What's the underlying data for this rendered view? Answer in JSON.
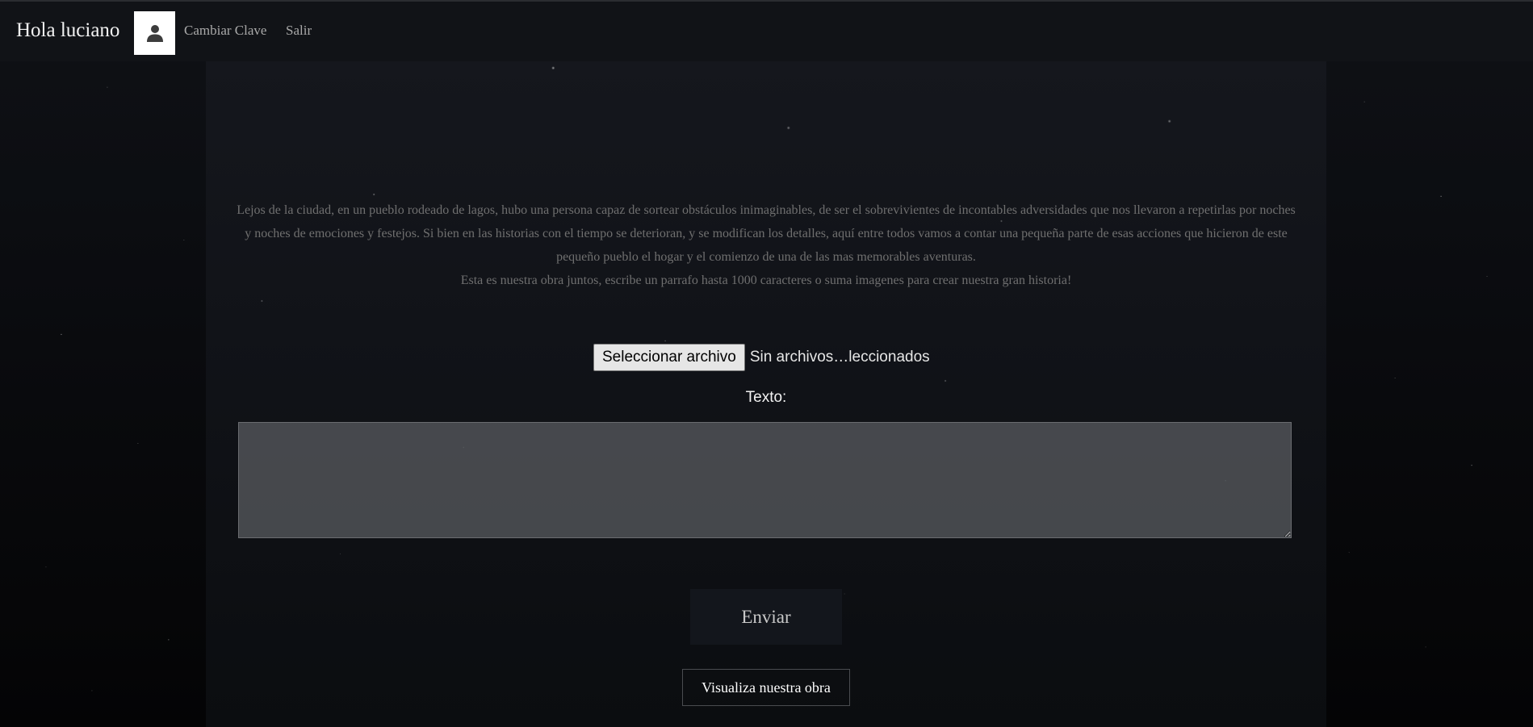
{
  "header": {
    "greeting": "Hola luciano",
    "avatar_icon": "user-icon",
    "links": {
      "change_password": "Cambiar Clave",
      "logout": "Salir"
    }
  },
  "main": {
    "intro_paragraph": "Lejos de la ciudad, en un pueblo rodeado de lagos, hubo una persona capaz de sortear obstáculos inimaginables, de ser el sobrevivientes de incontables adversidades que nos llevaron a repetirlas por noches y noches de emociones y festejos. Si bien en las historias con el tiempo se deterioran, y se modifican los detalles, aquí entre todos vamos a contar una pequeña parte de esas acciones que hicieron de este pequeño pueblo el hogar y el comienzo de una de las mas memorables aventuras.",
    "intro_cta": "Esta es nuestra obra juntos, escribe un parrafo hasta 1000 caracteres o suma imagenes para crear nuestra gran historia!",
    "file_input": {
      "button_label": "Seleccionar archivo",
      "status": "Sin archivos…leccionados"
    },
    "text_field": {
      "label": "Texto:",
      "value": ""
    },
    "submit_label": "Enviar",
    "view_label": "Visualiza nuestra obra"
  }
}
